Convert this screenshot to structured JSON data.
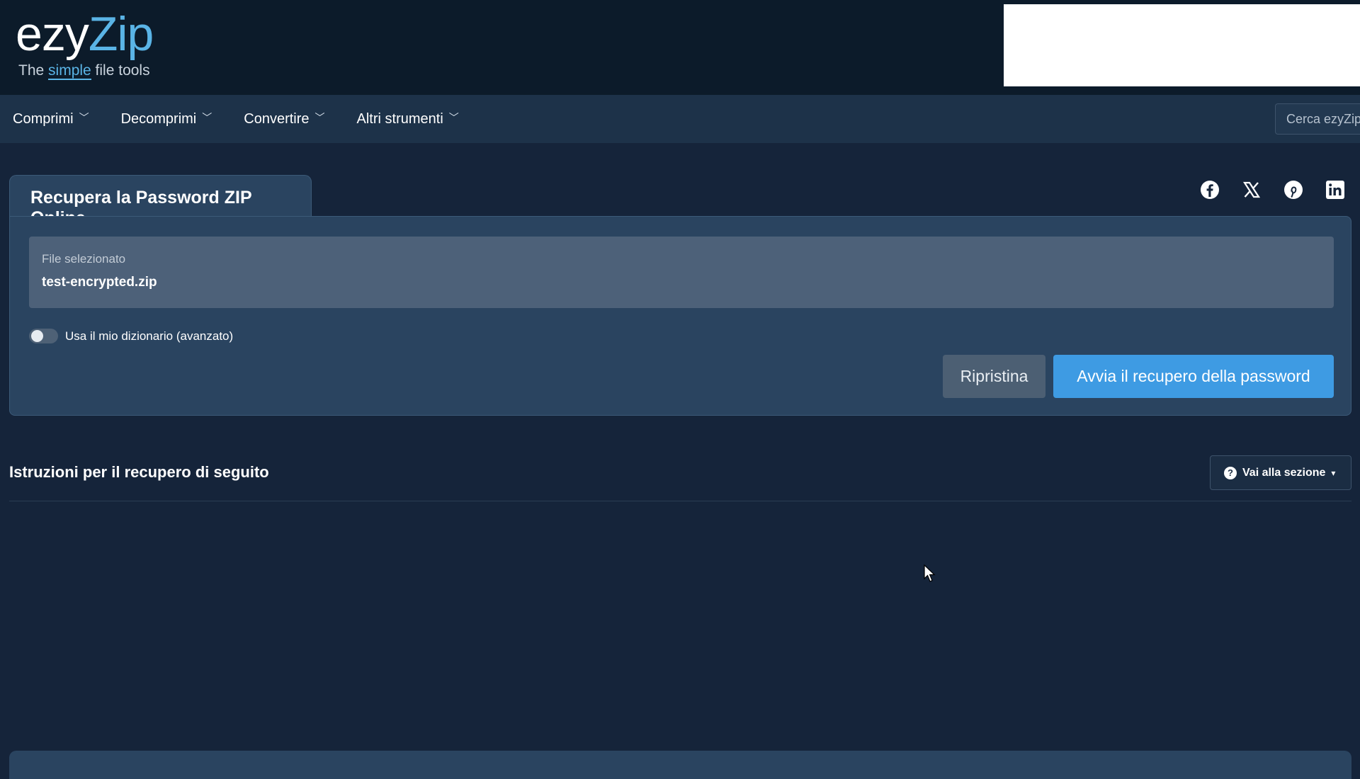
{
  "logo": {
    "part1": "ezy",
    "part2": "Zip",
    "tagline_before": "The ",
    "tagline_highlight": "simple",
    "tagline_after": " file tools"
  },
  "nav": {
    "items": [
      {
        "label": "Comprimi"
      },
      {
        "label": "Decomprimi"
      },
      {
        "label": "Convertire"
      },
      {
        "label": "Altri strumenti"
      }
    ],
    "search_placeholder": "Cerca ezyZip"
  },
  "tool": {
    "title": "Recupera la Password ZIP Online",
    "file_label": "File selezionato",
    "file_name": "test-encrypted.zip",
    "toggle_label": "Usa il mio dizionario (avanzato)",
    "toggle_on": false,
    "reset_label": "Ripristina",
    "start_label": "Avvia il recupero della password"
  },
  "social": {
    "icons": [
      "facebook-icon",
      "x-icon",
      "pinterest-icon",
      "linkedin-icon"
    ]
  },
  "instructions": {
    "title": "Istruzioni per il recupero di seguito",
    "goto_label": "Vai alla sezione"
  },
  "colors": {
    "page_bg": "#15243a",
    "header_bg": "#0c1b2a",
    "nav_bg": "#1d3249",
    "panel_bg": "#2a4460",
    "accent": "#3e9be3",
    "logo_accent": "#5ab4e6"
  }
}
